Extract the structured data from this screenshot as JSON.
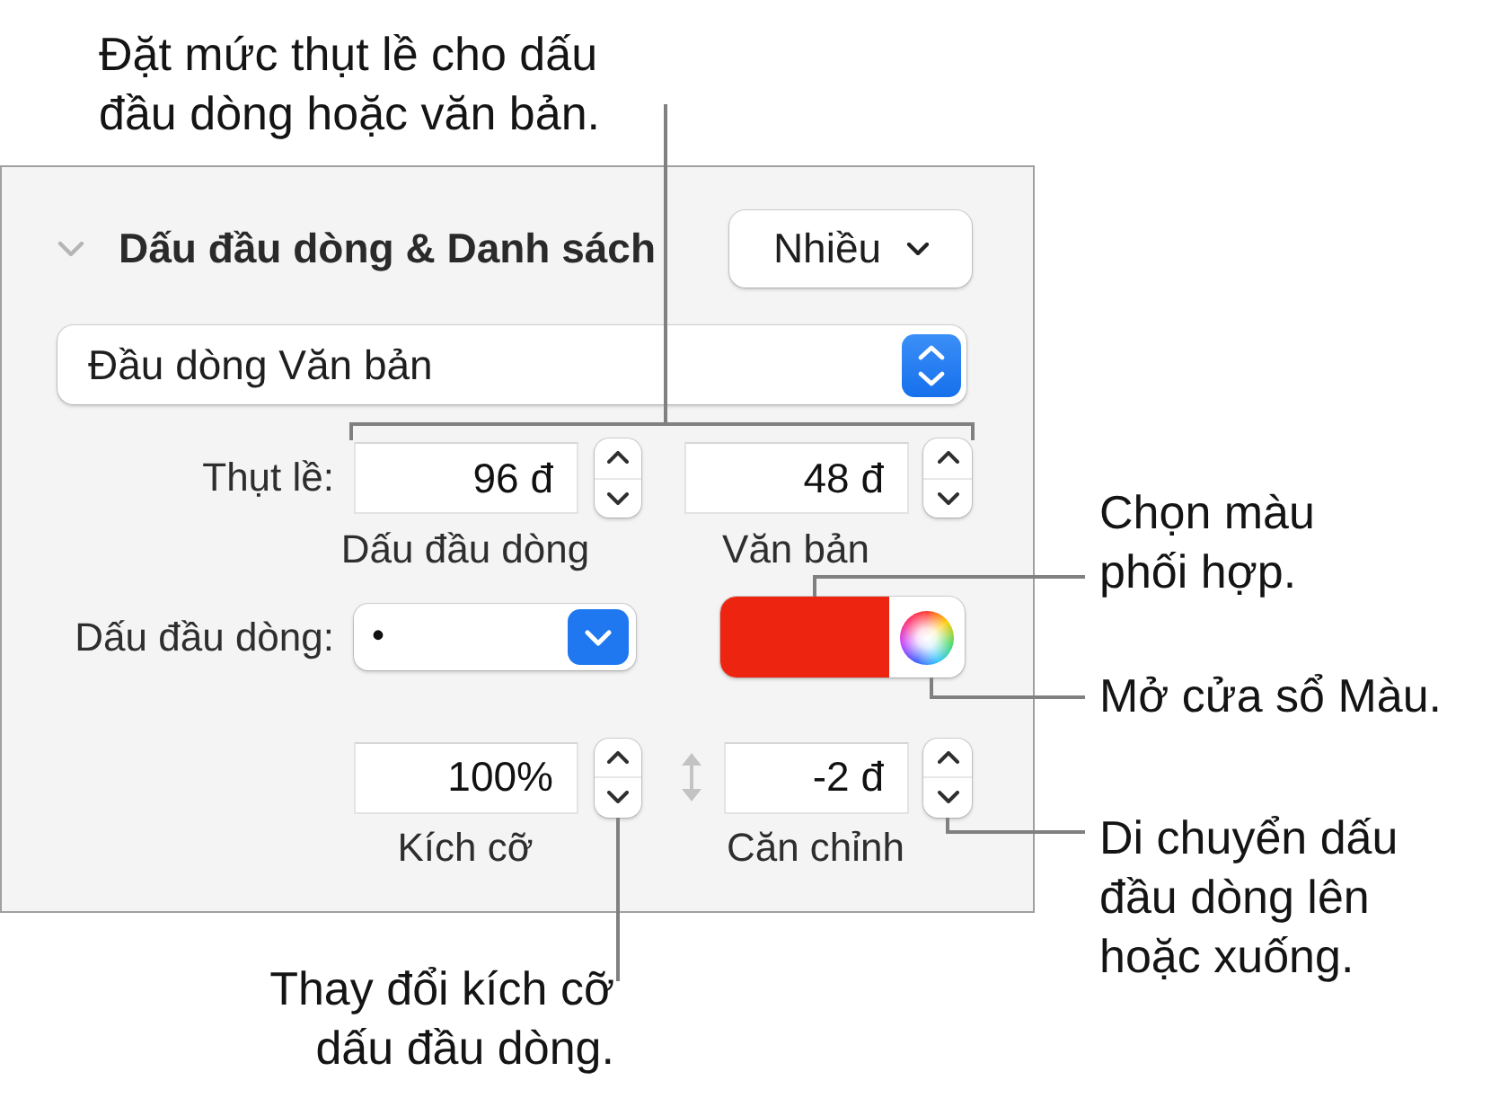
{
  "panel": {
    "section": {
      "title": "Dấu đầu dòng & Danh sách",
      "expanded": true,
      "preset": "Nhiều"
    },
    "list_style": "Đầu dòng Văn bản",
    "indent": {
      "label": "Thụt lề:",
      "fields": [
        {
          "value": "96 đ",
          "caption": "Dấu đầu dòng"
        },
        {
          "value": "48 đ",
          "caption": "Văn bản"
        }
      ]
    },
    "bullet": {
      "label": "Dấu đầu dòng:",
      "value": "•",
      "color": "#ec2410"
    },
    "size_alignment": {
      "fields": [
        {
          "value": "100%",
          "caption": "Kích cỡ"
        },
        {
          "value": "-2 đ",
          "caption": "Căn chỉnh"
        }
      ]
    }
  },
  "callouts": [
    {
      "text": "Đặt mức thụt lề cho dấu\nđầu dòng hoặc văn bản."
    },
    {
      "text": "Chọn màu\nphối hợp."
    },
    {
      "text": "Mở cửa sổ Màu."
    },
    {
      "text": "Di chuyển dấu\nđầu dòng lên\nhoặc xuống."
    },
    {
      "text": "Thay đổi kích cỡ\ndấu đầu dòng."
    }
  ]
}
